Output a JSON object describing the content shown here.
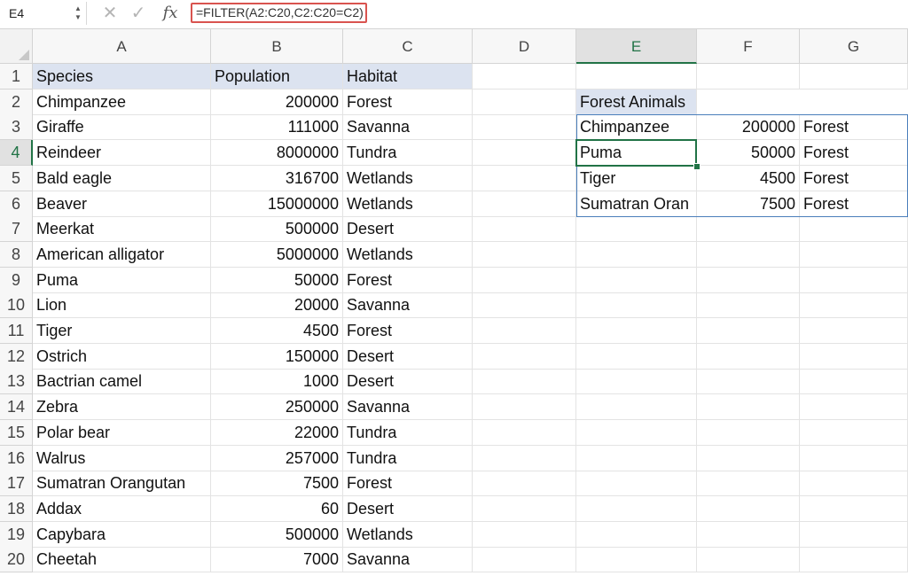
{
  "formula_bar": {
    "name_box": "E4",
    "cancel_glyph": "✕",
    "enter_glyph": "✓",
    "fx_label": "fx",
    "formula": "=FILTER(A2:C20,C2:C20=C2)"
  },
  "columns": [
    "A",
    "B",
    "C",
    "D",
    "E",
    "F",
    "G"
  ],
  "rows": [
    "1",
    "2",
    "3",
    "4",
    "5",
    "6",
    "7",
    "8",
    "9",
    "10",
    "11",
    "12",
    "13",
    "14",
    "15",
    "16",
    "17",
    "18",
    "19",
    "20"
  ],
  "headers": [
    "Species",
    "Population",
    "Habitat"
  ],
  "table": [
    [
      "Chimpanzee",
      "200000",
      "Forest"
    ],
    [
      "Giraffe",
      "111000",
      "Savanna"
    ],
    [
      "Reindeer",
      "8000000",
      "Tundra"
    ],
    [
      "Bald eagle",
      "316700",
      "Wetlands"
    ],
    [
      "Beaver",
      "15000000",
      "Wetlands"
    ],
    [
      "Meerkat",
      "500000",
      "Desert"
    ],
    [
      "American alligator",
      "5000000",
      "Wetlands"
    ],
    [
      "Puma",
      "50000",
      "Forest"
    ],
    [
      "Lion",
      "20000",
      "Savanna"
    ],
    [
      "Tiger",
      "4500",
      "Forest"
    ],
    [
      "Ostrich",
      "150000",
      "Desert"
    ],
    [
      "Bactrian camel",
      "1000",
      "Desert"
    ],
    [
      "Zebra",
      "250000",
      "Savanna"
    ],
    [
      "Polar bear",
      "22000",
      "Tundra"
    ],
    [
      "Walrus",
      "257000",
      "Tundra"
    ],
    [
      "Sumatran Orangutan",
      "7500",
      "Forest"
    ],
    [
      "Addax",
      "60",
      "Desert"
    ],
    [
      "Capybara",
      "500000",
      "Wetlands"
    ],
    [
      "Cheetah",
      "7000",
      "Savanna"
    ]
  ],
  "filter": {
    "title": "Forest Animals",
    "rows": [
      [
        "Chimpanzee",
        "200000",
        "Forest"
      ],
      [
        "Puma",
        "50000",
        "Forest"
      ],
      [
        "Tiger",
        "4500",
        "Forest"
      ],
      [
        "Sumatran Oran",
        "7500",
        "Forest"
      ]
    ]
  },
  "colors": {
    "header_fill": "#dce3f0",
    "selection_accent": "#217346",
    "spill_border": "#4a7ebb",
    "formula_highlight": "#d9534f"
  },
  "active_cell": "E4"
}
